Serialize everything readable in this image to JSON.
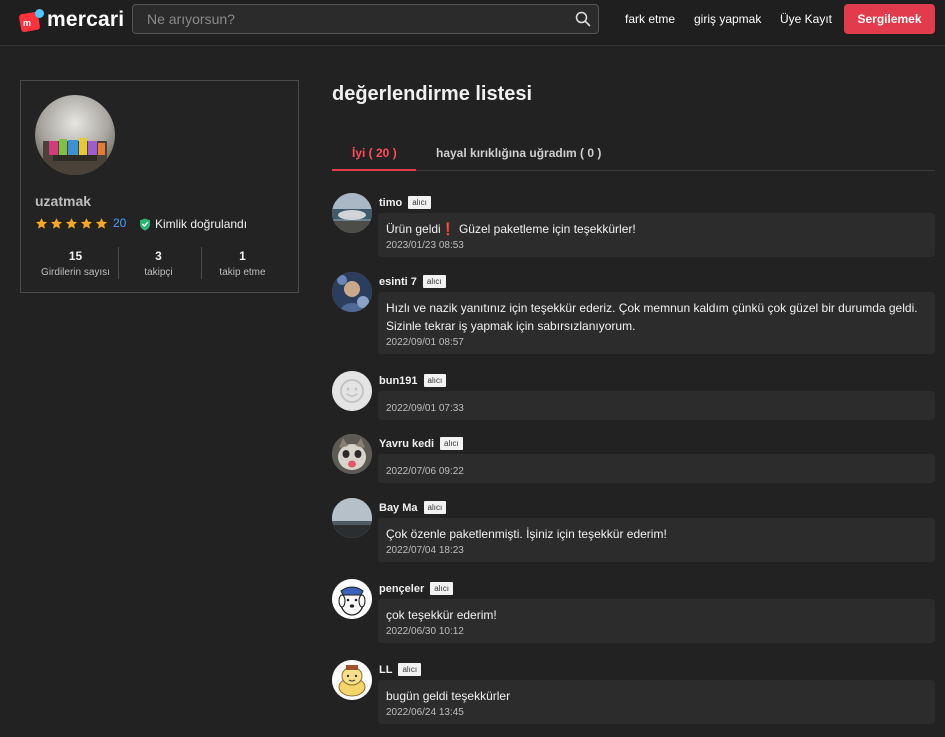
{
  "header": {
    "logo_text": "mercari",
    "search_placeholder": "Ne arıyorsun?",
    "nav": [
      "fark etme",
      "giriş yapmak",
      "Üye Kayıt"
    ],
    "sell_button": "Sergilemek"
  },
  "profile": {
    "username": "uzatmak",
    "rating_stars": 5,
    "rating_count": "20",
    "verified_label": "Kimlik doğrulandı",
    "stats": [
      {
        "value": "15",
        "label": "Girdilerin sayısı"
      },
      {
        "value": "3",
        "label": "takipçi"
      },
      {
        "value": "1",
        "label": "takip etme"
      }
    ]
  },
  "reviews_section": {
    "title": "değerlendirme listesi",
    "tabs": [
      "İyi ( 20 )",
      "hayal kırıklığına uğradım ( 0 )"
    ],
    "badge_label": "alıcı",
    "items": [
      {
        "name": "timo",
        "text": "Ürün geldi❗️ Güzel paketleme için teşekkürler!",
        "date": "2023/01/23 08:53"
      },
      {
        "name": "esinti 7",
        "text": "Hızlı ve nazik yanıtınız için teşekkür ederiz. Çok memnun kaldım çünkü çok güzel bir durumda geldi. Sizinle tekrar iş yapmak için sabırsızlanıyorum.",
        "date": "2022/09/01 08:57"
      },
      {
        "name": "bun191",
        "text": "",
        "date": "2022/09/01 07:33"
      },
      {
        "name": "Yavru kedi",
        "text": "",
        "date": "2022/07/06 09:22"
      },
      {
        "name": "Bay Ma",
        "text": "Çok özenle paketlenmişti. İşiniz için teşekkür ederim!",
        "date": "2022/07/04 18:23"
      },
      {
        "name": "pençeler",
        "text": "çok teşekkür ederim!",
        "date": "2022/06/30 10:12"
      },
      {
        "name": "LL",
        "text": "bugün geldi teşekkürler",
        "date": "2022/06/24 13:45"
      }
    ]
  },
  "colors": {
    "accent": "#e23b4b",
    "background": "#222222",
    "link_blue": "#4a9eff",
    "star": "#f5a623",
    "verified_green": "#2bb673"
  }
}
